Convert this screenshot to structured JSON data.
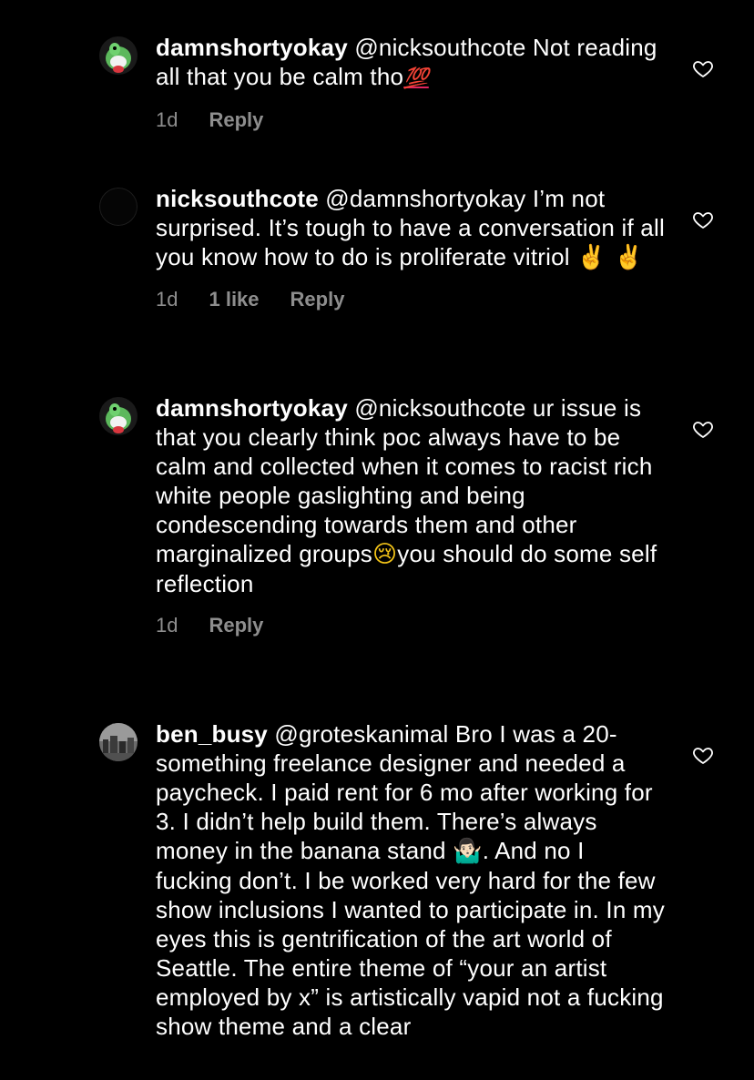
{
  "comments": [
    {
      "username": "damnshortyokay",
      "mention": "@nicksouthcote",
      "text_before_emoji": " Not reading all that you be calm tho",
      "emoji": "💯",
      "text_after_emoji": "",
      "time": "1d",
      "likes": "",
      "reply": "Reply",
      "avatar": "yoshi-avatar"
    },
    {
      "username": "nicksouthcote",
      "mention": "@damnshortyokay",
      "text_before_emoji": " I’m not surprised. It’s tough to have a conversation if all you know how to do is proliferate vitriol ",
      "emoji": "✌️ ✌️",
      "text_after_emoji": "",
      "time": "1d",
      "likes": "1 like",
      "reply": "Reply",
      "avatar": "dark-avatar"
    },
    {
      "username": "damnshortyokay",
      "mention": "@nicksouthcote",
      "text_before_emoji": " ur issue is that you clearly think poc always have to be calm and collected when it comes to racist rich white people gaslighting and being condescending towards them and other marginalized groups",
      "emoji": "😢",
      "text_after_emoji": "you should do some self reflection",
      "time": "1d",
      "likes": "",
      "reply": "Reply",
      "avatar": "yoshi-avatar"
    },
    {
      "username": "ben_busy",
      "mention": "@groteskanimal",
      "text_before_emoji": " Bro I was a 20-something freelance designer and needed a paycheck. I paid rent for 6 mo after working for 3. I didn’t help build them. There’s always money in the banana stand ",
      "emoji": "🤷🏻‍♂️",
      "text_after_emoji": ". And no I fucking don’t. I be worked very hard for the few show inclusions I wanted to participate in. In my eyes this is gentrification of the art world of Seattle. The entire theme of “your an artist employed by x” is artistically vapid not a fucking show theme and a clear",
      "time": "",
      "likes": "",
      "reply": "",
      "avatar": "photo-avatar"
    }
  ],
  "colors": {
    "background": "#000000",
    "text": "#ffffff",
    "meta": "#8e8e8e"
  },
  "icons": {
    "like": "heart-outline-icon"
  }
}
